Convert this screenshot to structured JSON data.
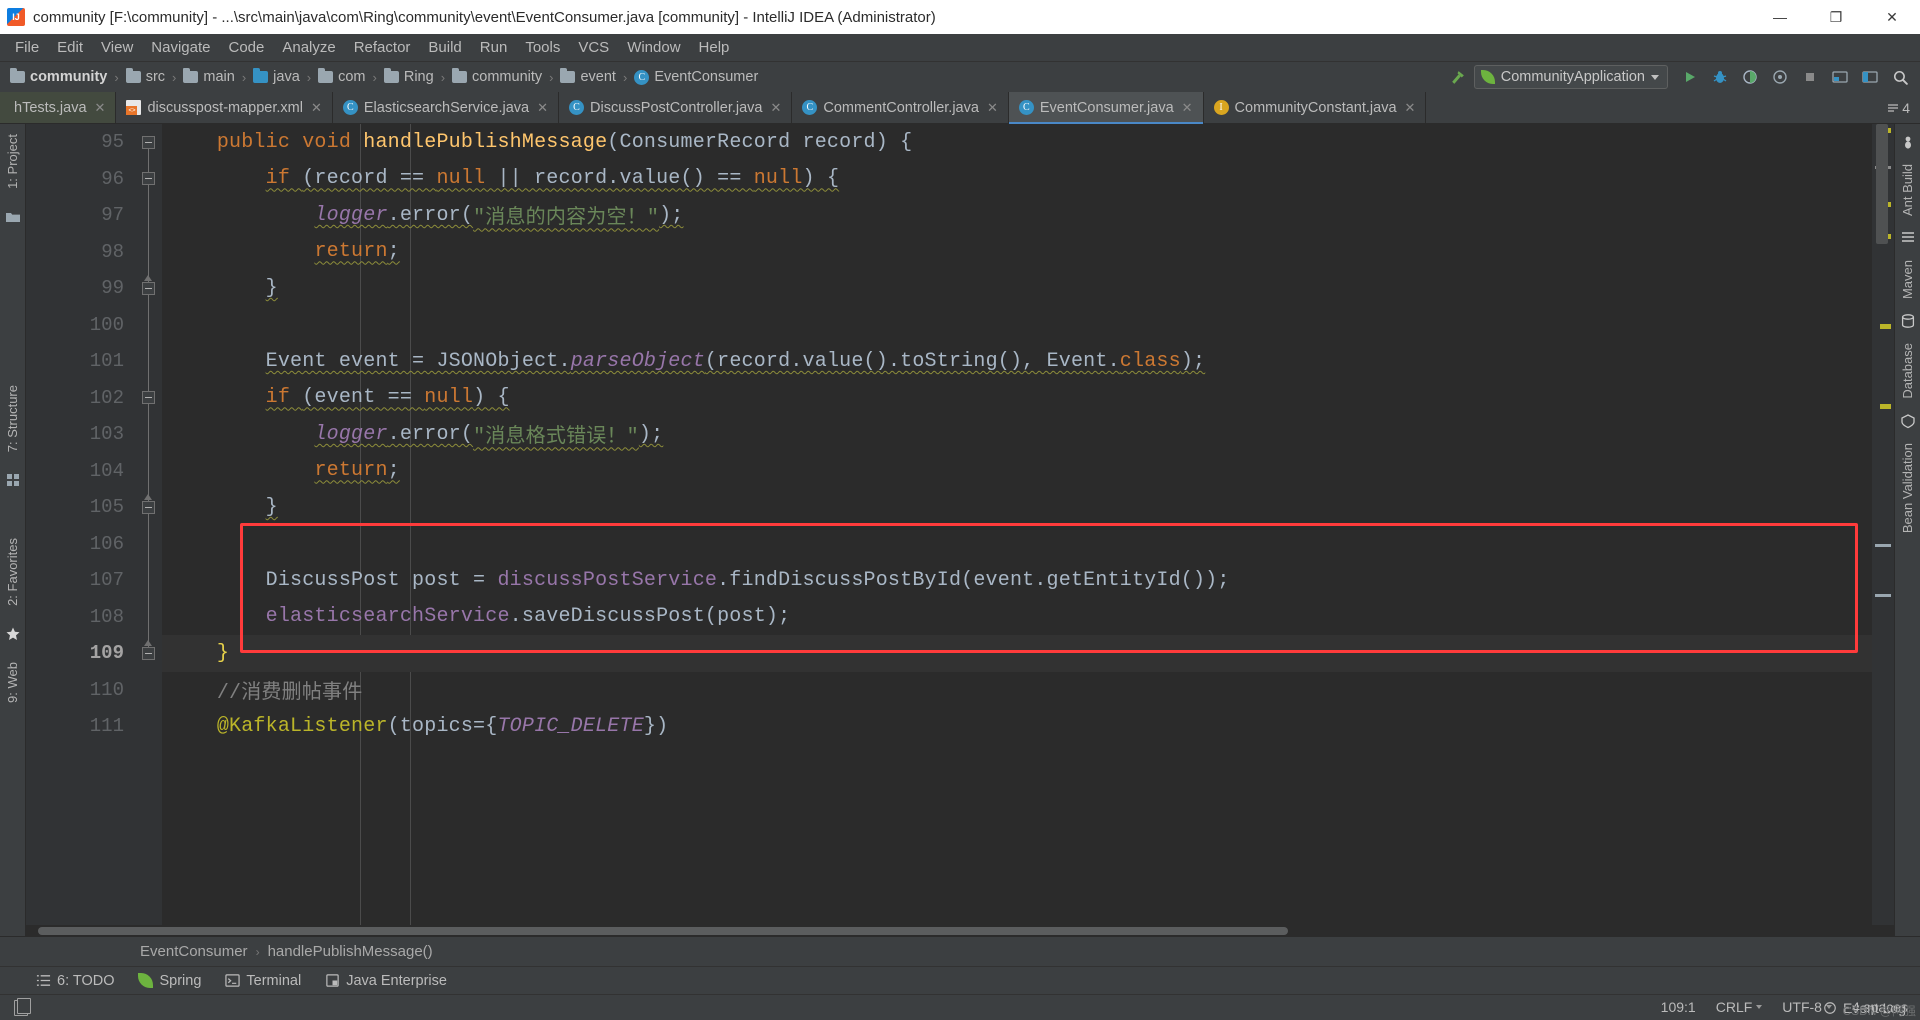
{
  "window": {
    "title": "community [F:\\community] - ...\\src\\main\\java\\com\\Ring\\community\\event\\EventConsumer.java [community] - IntelliJ IDEA (Administrator)",
    "app_icon": "intellij-idea-icon",
    "minimize": "—",
    "maximize": "❐",
    "close": "✕"
  },
  "menubar": {
    "items": [
      {
        "label": "File"
      },
      {
        "label": "Edit"
      },
      {
        "label": "View"
      },
      {
        "label": "Navigate"
      },
      {
        "label": "Code"
      },
      {
        "label": "Analyze"
      },
      {
        "label": "Refactor"
      },
      {
        "label": "Build"
      },
      {
        "label": "Run"
      },
      {
        "label": "Tools"
      },
      {
        "label": "VCS"
      },
      {
        "label": "Window"
      },
      {
        "label": "Help"
      }
    ]
  },
  "breadcrumb": {
    "separator": "›",
    "items": [
      {
        "label": "community",
        "icon": "folder-icon",
        "bold": true,
        "color": "grey"
      },
      {
        "label": "src",
        "icon": "folder-icon",
        "color": "grey"
      },
      {
        "label": "main",
        "icon": "folder-icon",
        "color": "grey"
      },
      {
        "label": "java",
        "icon": "folder-icon",
        "color": "blue"
      },
      {
        "label": "com",
        "icon": "folder-icon",
        "color": "grey"
      },
      {
        "label": "Ring",
        "icon": "folder-icon",
        "color": "grey"
      },
      {
        "label": "community",
        "icon": "folder-icon",
        "color": "grey"
      },
      {
        "label": "event",
        "icon": "folder-icon",
        "color": "grey"
      },
      {
        "label": "EventConsumer",
        "icon": "java-class-icon",
        "color": "class"
      }
    ]
  },
  "toolbar": {
    "run_config": {
      "label": "CommunityApplication",
      "icon": "spring-boot-icon",
      "dropdown": "▾"
    },
    "buttons": [
      {
        "name": "build-hammer-icon",
        "glyph": "⚒"
      },
      {
        "name": "run-button",
        "glyph": "▶"
      },
      {
        "name": "debug-button",
        "glyph": "ὁE"
      },
      {
        "name": "run-coverage-button",
        "glyph": "◑"
      },
      {
        "name": "profiler-button",
        "glyph": "◎"
      },
      {
        "name": "stop-button",
        "glyph": "■"
      },
      {
        "name": "update-app-button",
        "glyph": "↑"
      },
      {
        "name": "project-structure-button",
        "glyph": "⊞"
      },
      {
        "name": "search-everywhere-button",
        "glyph": "ὐD"
      }
    ]
  },
  "tabs": {
    "overflow_label": "4",
    "items": [
      {
        "label": "hTests.java",
        "icon": "java-class-icon",
        "state": "modified",
        "close": "✕"
      },
      {
        "label": "discusspost-mapper.xml",
        "icon": "xml-file-icon",
        "state": "normal",
        "close": "✕"
      },
      {
        "label": "ElasticsearchService.java",
        "icon": "java-class-icon",
        "state": "normal",
        "close": "✕"
      },
      {
        "label": "DiscussPostController.java",
        "icon": "java-class-icon",
        "state": "normal",
        "close": "✕"
      },
      {
        "label": "CommentController.java",
        "icon": "java-class-icon",
        "state": "normal",
        "close": "✕"
      },
      {
        "label": "EventConsumer.java",
        "icon": "java-class-icon",
        "state": "active",
        "close": "✕"
      },
      {
        "label": "CommunityConstant.java",
        "icon": "java-annotation-icon",
        "state": "normal",
        "close": "✕"
      }
    ]
  },
  "left_strip": {
    "items": [
      {
        "label": "1: Project",
        "name": "tool-window-project"
      },
      {
        "label": "7: Structure",
        "name": "tool-window-structure"
      },
      {
        "label": "2: Favorites",
        "name": "tool-window-favorites"
      },
      {
        "label": "9: Web",
        "name": "tool-window-web"
      }
    ],
    "icons": [
      "folder-icon",
      "grid-icon",
      "star-icon"
    ]
  },
  "right_strip": {
    "items": [
      {
        "label": "Ant Build",
        "name": "tool-window-ant-build"
      },
      {
        "label": "Maven",
        "name": "tool-window-maven"
      },
      {
        "label": "Database",
        "name": "tool-window-database"
      },
      {
        "label": "Bean Validation",
        "name": "tool-window-bean-validation"
      }
    ]
  },
  "editor": {
    "first_line": 95,
    "current_line": 109,
    "lines": [
      {
        "num": 95,
        "indent": 1,
        "fold": "start",
        "tokens": [
          {
            "t": "public ",
            "c": "kw"
          },
          {
            "t": "void ",
            "c": "kw"
          },
          {
            "t": "handlePublishMessage",
            "c": "def"
          },
          {
            "t": "(ConsumerRecord record) {",
            "c": "txt"
          }
        ]
      },
      {
        "num": 96,
        "indent": 2,
        "fold": "start",
        "squiggle": true,
        "tokens": [
          {
            "t": "if ",
            "c": "kw"
          },
          {
            "t": "(record == ",
            "c": "txt"
          },
          {
            "t": "null",
            "c": "kw"
          },
          {
            "t": " || record.value() == ",
            "c": "txt"
          },
          {
            "t": "null",
            "c": "kw"
          },
          {
            "t": ") {",
            "c": "txt"
          }
        ]
      },
      {
        "num": 97,
        "indent": 3,
        "squiggle": true,
        "tokens": [
          {
            "t": "logger",
            "c": "field"
          },
          {
            "t": ".error(",
            "c": "txt"
          },
          {
            "t": "\"消息的内容为空！\"",
            "c": "str"
          },
          {
            "t": ");",
            "c": "txt"
          }
        ]
      },
      {
        "num": 98,
        "indent": 3,
        "squiggle": true,
        "tokens": [
          {
            "t": "return",
            "c": "kw"
          },
          {
            "t": ";",
            "c": "txt"
          }
        ]
      },
      {
        "num": 99,
        "indent": 2,
        "fold": "end",
        "squiggle": true,
        "tokens": [
          {
            "t": "}",
            "c": "txt"
          }
        ]
      },
      {
        "num": 100,
        "indent": 0,
        "tokens": []
      },
      {
        "num": 101,
        "indent": 2,
        "squiggle": true,
        "tokens": [
          {
            "t": "Event event = JSONObject.",
            "c": "txt"
          },
          {
            "t": "parseObject",
            "c": "field"
          },
          {
            "t": "(record.value().toString(), Event.",
            "c": "txt"
          },
          {
            "t": "class",
            "c": "kw"
          },
          {
            "t": ");",
            "c": "txt"
          }
        ]
      },
      {
        "num": 102,
        "indent": 2,
        "fold": "start",
        "squiggle": true,
        "tokens": [
          {
            "t": "if ",
            "c": "kw"
          },
          {
            "t": "(event == ",
            "c": "txt"
          },
          {
            "t": "null",
            "c": "kw"
          },
          {
            "t": ") {",
            "c": "txt"
          }
        ]
      },
      {
        "num": 103,
        "indent": 3,
        "squiggle": true,
        "tokens": [
          {
            "t": "logger",
            "c": "field"
          },
          {
            "t": ".error(",
            "c": "txt"
          },
          {
            "t": "\"消息格式错误！\"",
            "c": "str"
          },
          {
            "t": ");",
            "c": "txt"
          }
        ]
      },
      {
        "num": 104,
        "indent": 3,
        "squiggle": true,
        "tokens": [
          {
            "t": "return",
            "c": "kw"
          },
          {
            "t": ";",
            "c": "txt"
          }
        ]
      },
      {
        "num": 105,
        "indent": 2,
        "fold": "end",
        "squiggle": true,
        "tokens": [
          {
            "t": "}",
            "c": "txt"
          }
        ]
      },
      {
        "num": 106,
        "indent": 0,
        "tokens": []
      },
      {
        "num": 107,
        "indent": 2,
        "tokens": [
          {
            "t": "DiscussPost post = ",
            "c": "txt"
          },
          {
            "t": "discussPostService",
            "c": "var"
          },
          {
            "t": ".findDiscussPostById(event.getEntityId());",
            "c": "txt"
          }
        ]
      },
      {
        "num": 108,
        "indent": 2,
        "tokens": [
          {
            "t": "elasticsearchService",
            "c": "var"
          },
          {
            "t": ".saveDiscussPost(post);",
            "c": "txt"
          }
        ]
      },
      {
        "num": 109,
        "indent": 1,
        "fold": "end",
        "current": true,
        "tokens": [
          {
            "t": "}",
            "c": "brace-y"
          }
        ]
      },
      {
        "num": 110,
        "indent": 1,
        "tokens": [
          {
            "t": "//消费删帖事件",
            "c": "cmt"
          }
        ]
      },
      {
        "num": 111,
        "indent": 1,
        "tokens": [
          {
            "t": "@KafkaListener",
            "c": "ann"
          },
          {
            "t": "(topics=",
            "c": "txt"
          },
          {
            "t": "{",
            "c": "txt"
          },
          {
            "t": "TOPIC_DELETE",
            "c": "const"
          },
          {
            "t": "}",
            "c": "txt"
          },
          {
            "t": ")",
            "c": "txt"
          }
        ]
      }
    ],
    "annotation": {
      "name": "red-highlight-rectangle",
      "color": "#ff3b3b"
    }
  },
  "nav_footer": {
    "separator": "›",
    "items": [
      "EventConsumer",
      "handlePublishMessage()"
    ]
  },
  "bottombar": {
    "items": [
      {
        "label": "6: TODO",
        "icon": "todo-list-icon",
        "mnemonic": "6"
      },
      {
        "label": "Spring",
        "icon": "spring-leaf-icon"
      },
      {
        "label": "Terminal",
        "icon": "terminal-icon"
      },
      {
        "label": "Java Enterprise",
        "icon": "java-enterprise-icon"
      }
    ]
  },
  "statusbar": {
    "left_icon": "show-tool-windows-icon",
    "caret_position": "109:1",
    "line_separator": "CRLF",
    "encoding": "UTF-8",
    "indent": "4 spaces",
    "event_log": "Event Log",
    "event_log_icon": "event-log-icon",
    "watermark": "CSDN @阿强"
  }
}
